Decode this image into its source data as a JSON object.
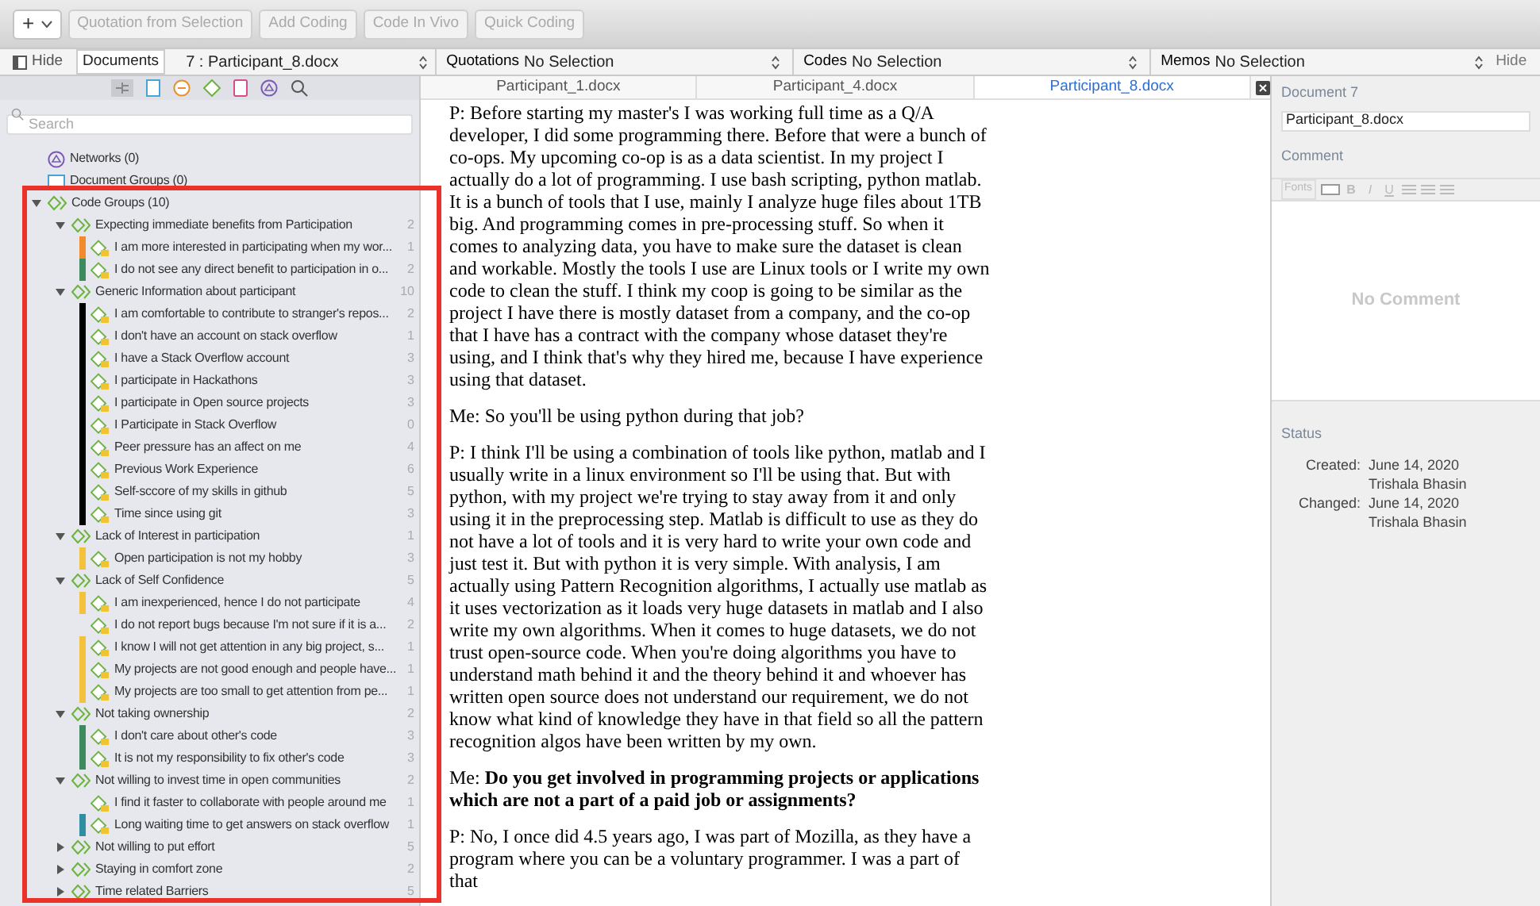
{
  "toolbar": {
    "add_button": "+",
    "buttons": [
      "Quotation from Selection",
      "Add Coding",
      "Code In Vivo",
      "Quick Coding"
    ]
  },
  "nav_bar": {
    "hide_left": "Hide",
    "documents_label": "Documents",
    "document_select": "7 : Participant_8.docx",
    "quotations_label": "Quotations",
    "quotations_value": "No Selection",
    "codes_label": "Codes",
    "codes_value": "No Selection",
    "memos_label": "Memos",
    "memos_value": "No Selection",
    "hide_right": "Hide"
  },
  "navigator": {
    "search_placeholder": "Search",
    "tree": [
      {
        "kind": "network",
        "label": "Networks (0)"
      },
      {
        "kind": "docgroup",
        "label": "Document Groups (0)"
      },
      {
        "kind": "group",
        "label": "Code Groups (10)",
        "expanded": true,
        "children": [
          {
            "kind": "group",
            "label": "Expecting immediate benefits from Participation",
            "count": "2",
            "expanded": true,
            "children": [
              {
                "kind": "code",
                "label": "I am more interested in participating when my wor...",
                "count": "1",
                "color": "#f08a2c"
              },
              {
                "kind": "code",
                "label": "I do not see any direct benefit to participation in o...",
                "count": "2",
                "color": "#3d8a5f"
              }
            ]
          },
          {
            "kind": "group",
            "label": "Generic Information about participant",
            "count": "10",
            "expanded": true,
            "children": [
              {
                "kind": "code",
                "label": "I am comfortable to contribute to stranger's repos...",
                "count": "2",
                "color": "#000000"
              },
              {
                "kind": "code",
                "label": "I don't have an account on stack overflow",
                "count": "1",
                "color": "#000000"
              },
              {
                "kind": "code",
                "label": "I have a Stack Overflow account",
                "count": "3",
                "color": "#000000"
              },
              {
                "kind": "code",
                "label": "I participate in Hackathons",
                "count": "3",
                "color": "#000000"
              },
              {
                "kind": "code",
                "label": "I participate in Open source projects",
                "count": "3",
                "color": "#000000"
              },
              {
                "kind": "code",
                "label": "I Participate in Stack Overflow",
                "count": "0",
                "color": "#000000"
              },
              {
                "kind": "code",
                "label": "Peer pressure has an affect on me",
                "count": "4",
                "color": "#000000"
              },
              {
                "kind": "code",
                "label": "Previous Work Experience",
                "count": "6",
                "color": "#000000"
              },
              {
                "kind": "code",
                "label": "Self-sccore of my skills in github",
                "count": "5",
                "color": "#000000"
              },
              {
                "kind": "code",
                "label": "Time since using git",
                "count": "3",
                "color": "#000000"
              }
            ]
          },
          {
            "kind": "group",
            "label": "Lack of Interest in participation",
            "count": "1",
            "expanded": true,
            "children": [
              {
                "kind": "code",
                "label": "Open participation is not my hobby",
                "count": "3",
                "color": "#f3c13e"
              }
            ]
          },
          {
            "kind": "group",
            "label": "Lack of Self Confidence",
            "count": "5",
            "expanded": true,
            "children": [
              {
                "kind": "code",
                "label": "I am inexperienced, hence I do not participate",
                "count": "4",
                "color": "#f3c13e"
              },
              {
                "kind": "code",
                "label": "I do not report bugs because I'm not sure if it is a...",
                "count": "2"
              },
              {
                "kind": "code",
                "label": "I know I will not get attention in any big project, s...",
                "count": "1",
                "color": "#f3c13e"
              },
              {
                "kind": "code",
                "label": "My projects are not good enough and people have...",
                "count": "1",
                "color": "#f3c13e"
              },
              {
                "kind": "code",
                "label": "My projects are too small to get attention from pe...",
                "count": "1",
                "color": "#f3c13e"
              }
            ]
          },
          {
            "kind": "group",
            "label": "Not taking ownership",
            "count": "2",
            "expanded": true,
            "children": [
              {
                "kind": "code",
                "label": "I don't care about other's code",
                "count": "3",
                "color": "#3d8a5f"
              },
              {
                "kind": "code",
                "label": "It is not my responsibility to fix other's code",
                "count": "3",
                "color": "#3d8a5f"
              }
            ]
          },
          {
            "kind": "group",
            "label": "Not willing to invest time in open communities",
            "count": "2",
            "expanded": true,
            "children": [
              {
                "kind": "code",
                "label": "I find it faster to collaborate with people around me",
                "count": "1"
              },
              {
                "kind": "code",
                "label": "Long waiting time to get answers on stack overflow",
                "count": "1",
                "color": "#2f8fa0"
              }
            ]
          },
          {
            "kind": "group",
            "label": "Not willing to put effort",
            "count": "5",
            "expanded": false
          },
          {
            "kind": "group",
            "label": "Staying in comfort zone",
            "count": "2",
            "expanded": false
          },
          {
            "kind": "group",
            "label": "Time related Barriers",
            "count": "5",
            "expanded": false
          }
        ]
      }
    ]
  },
  "tabs": [
    {
      "label": "Participant_1.docx",
      "selected": false
    },
    {
      "label": "Participant_4.docx",
      "selected": false
    },
    {
      "label": "Participant_8.docx",
      "selected": true
    }
  ],
  "document": {
    "paragraphs": [
      "P: Before starting my master's I was working full time as a Q/A developer, I did some programming there. Before that were a bunch of co-ops. My upcoming co-op is as a data scientist. In my project I actually do a lot of programming. I use bash scripting, python matlab. It is a bunch of tools that I use, mainly I analyze huge files about 1TB big. And programming comes in pre-processing stuff. So when it comes to analyzing data, you have to make sure the dataset is clean and workable. Mostly the tools I use are Linux tools or I write my own code to clean the stuff. I think my coop is going to be similar as the project I have there is mostly dataset from a company, and the co-op that I have has a contract with the company whose dataset they're using, and I think that's why they hired me, because I have experience using that dataset.",
      "Me: So you'll be using python during that job?",
      "P: I think I'll be using a combination of tools like python, matlab and I usually write in a linux environment so I'll be using that. But with python, with my project we're trying to stay away from it and only using it in the preprocessing step. Matlab is difficult to use as they do not have a lot of tools and it is very hard to write your own code and just test it. But with python it is very simple. With analysis, I am actually using Pattern Recognition algorithms, I actually use matlab as it uses vectorization as it loads very huge datasets in matlab and I also write my own algorithms. When it comes to huge datasets, we do not trust open-source code. When you're doing algorithms you have to understand math behind it and the theory behind it and whoever has written open source does not understand our requirement, we do not know what kind of knowledge they have in that field so all the pattern recognition algos have been written by my own.",
      "Me: **Do you get involved in programming projects or applications which are not a part of a paid job or assignments?**",
      "P: No, I once did 4.5 years ago, I was part of Mozilla, as they have a program where you can be a voluntary programmer. I was a part of that"
    ]
  },
  "inspector": {
    "title": "Document 7",
    "name_value": "Participant_8.docx",
    "comment_label": "Comment",
    "fonts_label": "Fonts",
    "format_buttons": [
      "B",
      "I",
      "U"
    ],
    "empty_text": "No Comment",
    "status_label": "Status",
    "status": [
      {
        "label": "Created:",
        "date": "June 14, 2020",
        "author": "Trishala Bhasin"
      },
      {
        "label": "Changed:",
        "date": "June 14, 2020",
        "author": "Trishala Bhasin"
      }
    ]
  }
}
